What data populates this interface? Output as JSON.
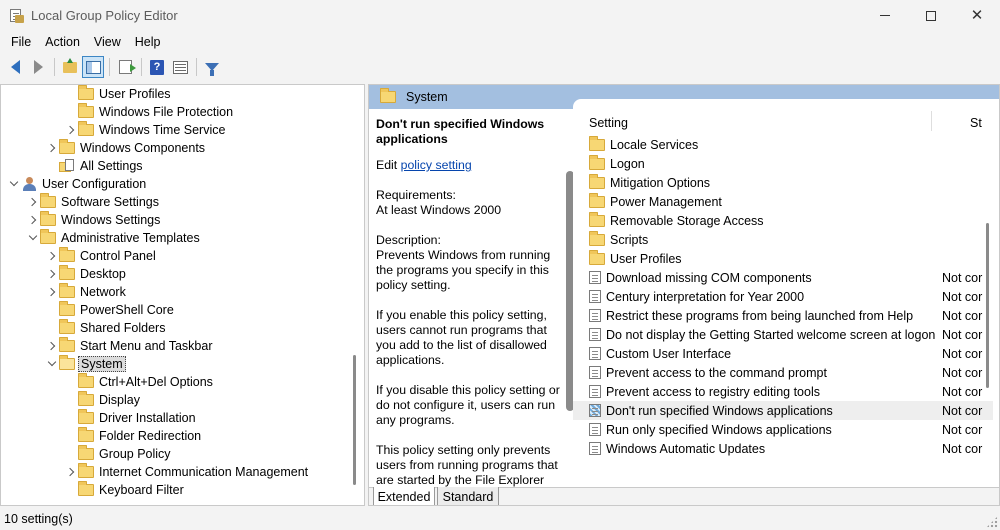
{
  "window": {
    "title": "Local Group Policy Editor",
    "minimize_icon": "minimize-icon",
    "maximize_icon": "maximize-icon",
    "close_icon": "close-icon"
  },
  "menu": [
    "File",
    "Action",
    "View",
    "Help"
  ],
  "toolbar": {
    "buttons": [
      "back-arrow-icon",
      "forward-arrow-icon",
      "up-folder-icon",
      "show-hide-tree-icon",
      "export-list-icon",
      "help-icon",
      "extended-view-icon",
      "filter-icon"
    ]
  },
  "tree": {
    "items": [
      {
        "label": "User Profiles",
        "indent": 3,
        "chevron": "none",
        "icon": "folder"
      },
      {
        "label": "Windows File Protection",
        "indent": 3,
        "chevron": "none",
        "icon": "folder"
      },
      {
        "label": "Windows Time Service",
        "indent": 3,
        "chevron": "right",
        "icon": "folder"
      },
      {
        "label": "Windows Components",
        "indent": 2,
        "chevron": "right",
        "icon": "folder"
      },
      {
        "label": "All Settings",
        "indent": 2,
        "chevron": "none",
        "icon": "all-settings"
      },
      {
        "label": "User Configuration",
        "indent": 0,
        "chevron": "down",
        "icon": "user"
      },
      {
        "label": "Software Settings",
        "indent": 1,
        "chevron": "right",
        "icon": "folder"
      },
      {
        "label": "Windows Settings",
        "indent": 1,
        "chevron": "right",
        "icon": "folder"
      },
      {
        "label": "Administrative Templates",
        "indent": 1,
        "chevron": "down",
        "icon": "folder"
      },
      {
        "label": "Control Panel",
        "indent": 2,
        "chevron": "right",
        "icon": "folder"
      },
      {
        "label": "Desktop",
        "indent": 2,
        "chevron": "right",
        "icon": "folder"
      },
      {
        "label": "Network",
        "indent": 2,
        "chevron": "right",
        "icon": "folder"
      },
      {
        "label": "PowerShell Core",
        "indent": 2,
        "chevron": "none",
        "icon": "folder"
      },
      {
        "label": "Shared Folders",
        "indent": 2,
        "chevron": "none",
        "icon": "folder"
      },
      {
        "label": "Start Menu and Taskbar",
        "indent": 2,
        "chevron": "right",
        "icon": "folder"
      },
      {
        "label": "System",
        "indent": 2,
        "chevron": "down",
        "icon": "folder-open",
        "selected": true
      },
      {
        "label": "Ctrl+Alt+Del Options",
        "indent": 3,
        "chevron": "none",
        "icon": "folder"
      },
      {
        "label": "Display",
        "indent": 3,
        "chevron": "none",
        "icon": "folder"
      },
      {
        "label": "Driver Installation",
        "indent": 3,
        "chevron": "none",
        "icon": "folder"
      },
      {
        "label": "Folder Redirection",
        "indent": 3,
        "chevron": "none",
        "icon": "folder"
      },
      {
        "label": "Group Policy",
        "indent": 3,
        "chevron": "none",
        "icon": "folder"
      },
      {
        "label": "Internet Communication Management",
        "indent": 3,
        "chevron": "right",
        "icon": "folder"
      },
      {
        "label": "Keyboard Filter",
        "indent": 3,
        "chevron": "none",
        "icon": "folder"
      }
    ]
  },
  "details": {
    "header_title": "System",
    "description": {
      "title": "Don't run specified Windows applications",
      "edit_prefix": "Edit",
      "edit_link": "policy setting",
      "requirements_label": "Requirements:",
      "requirements_value": "At least Windows 2000",
      "description_label": "Description:",
      "p1": "Prevents Windows from running the programs you specify in this policy setting.",
      "p2": "If you enable this policy setting, users cannot run programs that you add to the list of disallowed applications.",
      "p3": "If you disable this policy setting or do not configure it, users can run any programs.",
      "p4": "This policy setting only prevents users from running programs that are started by the File Explorer"
    },
    "columns": {
      "setting": "Setting",
      "state": "St"
    },
    "rows": [
      {
        "name": "Locale Services",
        "type": "folder",
        "state": ""
      },
      {
        "name": "Logon",
        "type": "folder",
        "state": ""
      },
      {
        "name": "Mitigation Options",
        "type": "folder",
        "state": ""
      },
      {
        "name": "Power Management",
        "type": "folder",
        "state": ""
      },
      {
        "name": "Removable Storage Access",
        "type": "folder",
        "state": ""
      },
      {
        "name": "Scripts",
        "type": "folder",
        "state": ""
      },
      {
        "name": "User Profiles",
        "type": "folder",
        "state": ""
      },
      {
        "name": "Download missing COM components",
        "type": "policy",
        "state": "Not cor"
      },
      {
        "name": "Century interpretation for Year 2000",
        "type": "policy",
        "state": "Not cor"
      },
      {
        "name": "Restrict these programs from being launched from Help",
        "type": "policy",
        "state": "Not cor"
      },
      {
        "name": "Do not display the Getting Started welcome screen at logon",
        "type": "policy",
        "state": "Not cor"
      },
      {
        "name": "Custom User Interface",
        "type": "policy",
        "state": "Not cor"
      },
      {
        "name": "Prevent access to the command prompt",
        "type": "policy",
        "state": "Not cor"
      },
      {
        "name": "Prevent access to registry editing tools",
        "type": "policy",
        "state": "Not cor"
      },
      {
        "name": "Don't run specified Windows applications",
        "type": "policy-special",
        "state": "Not cor",
        "highlighted": true
      },
      {
        "name": "Run only specified Windows applications",
        "type": "policy",
        "state": "Not cor"
      },
      {
        "name": "Windows Automatic Updates",
        "type": "policy",
        "state": "Not cor"
      }
    ],
    "tabs": {
      "extended": "Extended",
      "standard": "Standard"
    }
  },
  "status": {
    "text": "10 setting(s)"
  }
}
